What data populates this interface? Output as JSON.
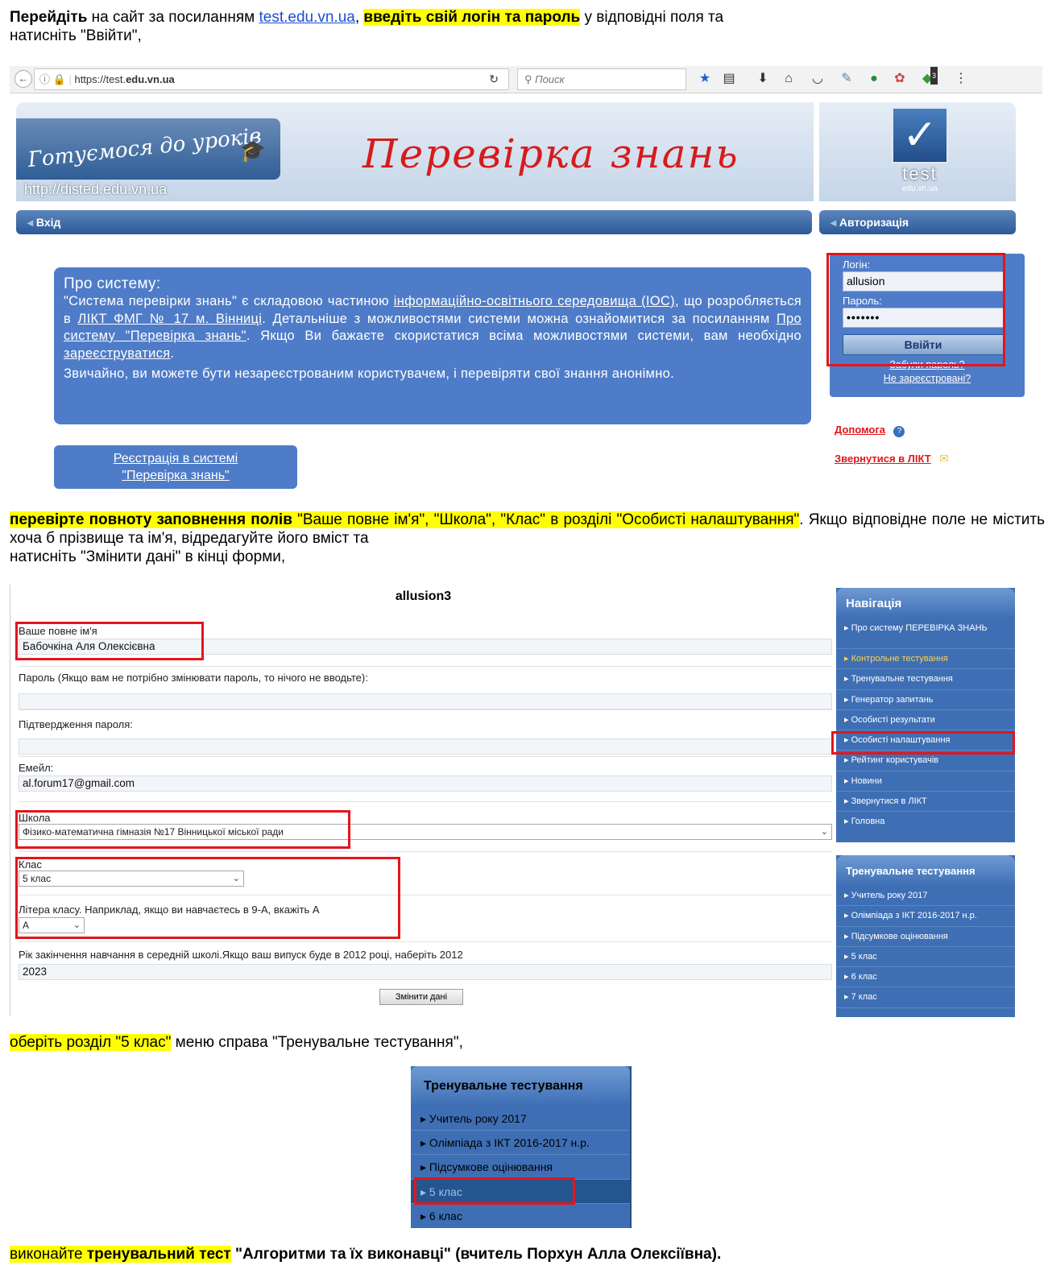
{
  "step1": {
    "lead": "Перейдіть",
    "t1": " на сайт за посиланням ",
    "link": "test.edu.vn.ua",
    "t2": ", ",
    "hl": "введіть свій логін та пароль",
    "t3": " у відповідні поля та",
    "line2": "натисніть \"Ввійти\","
  },
  "browser": {
    "url_plain": "https://test.",
    "url_bold": "edu.vn.ua",
    "search_placeholder": "Поиск",
    "badge": "3"
  },
  "site1": {
    "logo_text": "Готуємося до уроків",
    "script_title": "Перевірка знань",
    "site_url": "http://disted.edu.vn.ua",
    "test_logo": "test",
    "test_logo_sub": "edu.vn.ua",
    "bar_left": "Вхід",
    "bar_right": "Авторизація",
    "about_title": "Про систему:",
    "about_a": "\"Система перевірки знань\" є складовою частиною ",
    "about_link1": "інформаційно-освітнього середовища (ІОС)",
    "about_b": ", що розробляється в ",
    "about_link2": "ЛІКТ ФМГ № 17 м. Вінниці",
    "about_c": ". Детальніше з можливостями системи можна ознайомитися за посиланням ",
    "about_link3": "Про систему \"Перевірка знань\"",
    "about_d": ". Якщо Ви бажаєте скористатися всіма можливостями системи, вам необхідно ",
    "about_link4": "зареєструватися",
    "about_e": ".",
    "about_p2": "Звичайно, ви можете бути незареєстрованим користувачем, і перевіряти свої знання анонімно.",
    "reg_line1": "Реєстрація в системі",
    "reg_line2": "\"Перевірка знань\"",
    "login_label": "Логін:",
    "login_value": "allusion",
    "pass_label": "Пароль:",
    "pass_value": "•••••••",
    "login_button": "Ввійти",
    "forgot": "Забули пароль?",
    "not_registered": "Не зареєстровані?",
    "help": "Допомога",
    "contact": "Звернутися в ЛІКТ"
  },
  "step2": {
    "hl_bold": "перевірте повноту заповнення полів",
    "hl_rest": " \"Ваше повне ім'я\", \"Школа\", \"Клас\" в розділі \"Особисті налаштування\"",
    "t1": ". Якщо відповідне поле не містить хоча б прізвище та ім'я, відредагуйте його вміст та",
    "line3": "натисніть \"Змінити дані\" в кінці форми,"
  },
  "form": {
    "username": "allusion3",
    "name_label": "Ваше повне ім'я",
    "name_value": "Бабочкіна Аля Олексієвна",
    "pass_label": "Пароль (Якщо вам не потрібно змінювати пароль, то нічого не вводьте):",
    "confirm_label": "Підтвердження пароля:",
    "email_label": "Емейл:",
    "email_value": "al.forum17@gmail.com",
    "school_label": "Школа",
    "school_value": "Фізико-математична гімназія №17 Вінницької міської ради",
    "class_label": "Клас",
    "class_value": "5 клас",
    "letter_label": "Літера класу. Наприклад, якщо ви навчаєтесь в 9-А, вкажіть А",
    "letter_value": "А",
    "year_label": "Рік закінчення навчання в середній школі.Якщо ваш випуск буде в 2012 році, наберіть 2012",
    "year_value": "2023",
    "submit": "Змінити дані"
  },
  "nav": {
    "head": "Навігація",
    "items": [
      "Про систему ПЕРЕВІРКА ЗНАНЬ",
      "Контрольне тестування",
      "Тренувальне тестування",
      "Генератор запитань",
      "Особисті результати",
      "Особисті налаштування",
      "Рейтинг користувачів",
      "Новини",
      "Звернутися в ЛІКТ",
      "Головна"
    ]
  },
  "train": {
    "head": "Тренувальне тестування",
    "items": [
      "Учитель року 2017",
      "Олімпіада з ІКТ 2016-2017 н.р.",
      "Підсумкове оцінювання",
      "5 клас",
      "6 клас",
      "7 клас"
    ]
  },
  "step3": {
    "hl": "оберіть розділ \"5 клас\"",
    "t1": " меню справа \"Тренувальне тестування\","
  },
  "step4": {
    "hl1": "виконайте ",
    "hl_bold": "тренувальний тест",
    "t1": " \"Алгоритми та їх виконавці\" (вчитель Порхун Алла Олексіївна)."
  }
}
